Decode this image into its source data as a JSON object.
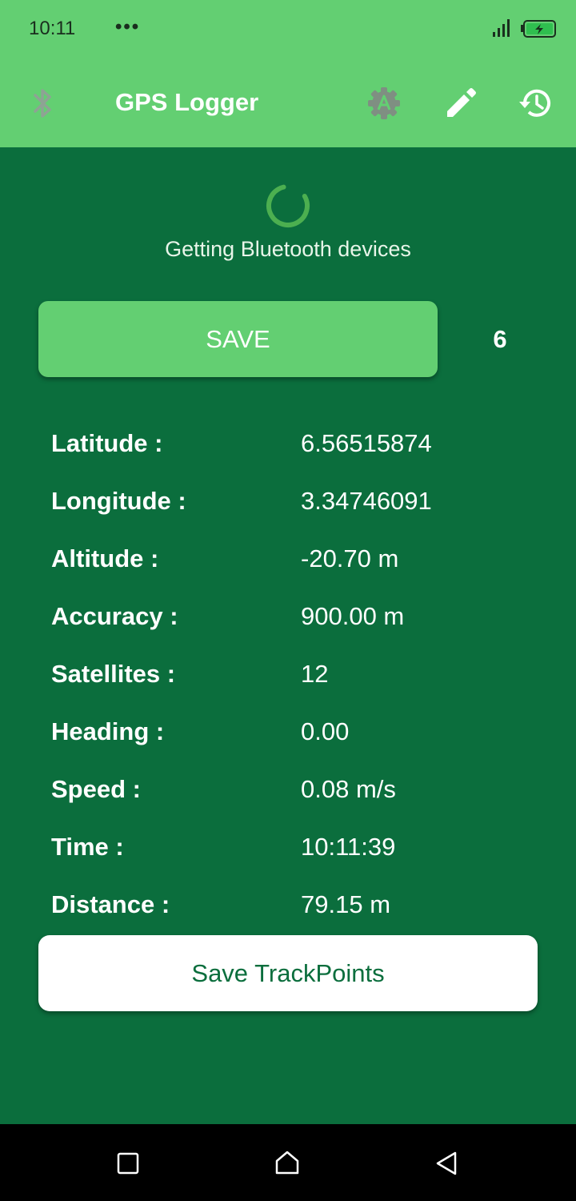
{
  "status_bar": {
    "time": "10:11",
    "dots": "•••"
  },
  "app_bar": {
    "title": "GPS Logger",
    "icons": [
      "bluetooth-icon",
      "gear-icon",
      "edit-icon",
      "history-icon"
    ]
  },
  "loading": {
    "text": "Getting Bluetooth devices"
  },
  "save": {
    "label": "SAVE",
    "count": "6"
  },
  "info": [
    {
      "label": "Latitude :",
      "value": "6.56515874"
    },
    {
      "label": "Longitude :",
      "value": "3.34746091"
    },
    {
      "label": "Altitude :",
      "value": "-20.70 m"
    },
    {
      "label": "Accuracy :",
      "value": "900.00 m"
    },
    {
      "label": "Satellites :",
      "value": "12"
    },
    {
      "label": "Heading :",
      "value": "0.00"
    },
    {
      "label": "Speed :",
      "value": "0.08 m/s"
    },
    {
      "label": "Time :",
      "value": "10:11:39"
    },
    {
      "label": "Distance :",
      "value": "79.15 m"
    }
  ],
  "trackpoints_button": {
    "label": "Save TrackPoints"
  },
  "colors": {
    "background": "#0b6e3d",
    "accent": "#63cf72",
    "text": "#ffffff"
  }
}
